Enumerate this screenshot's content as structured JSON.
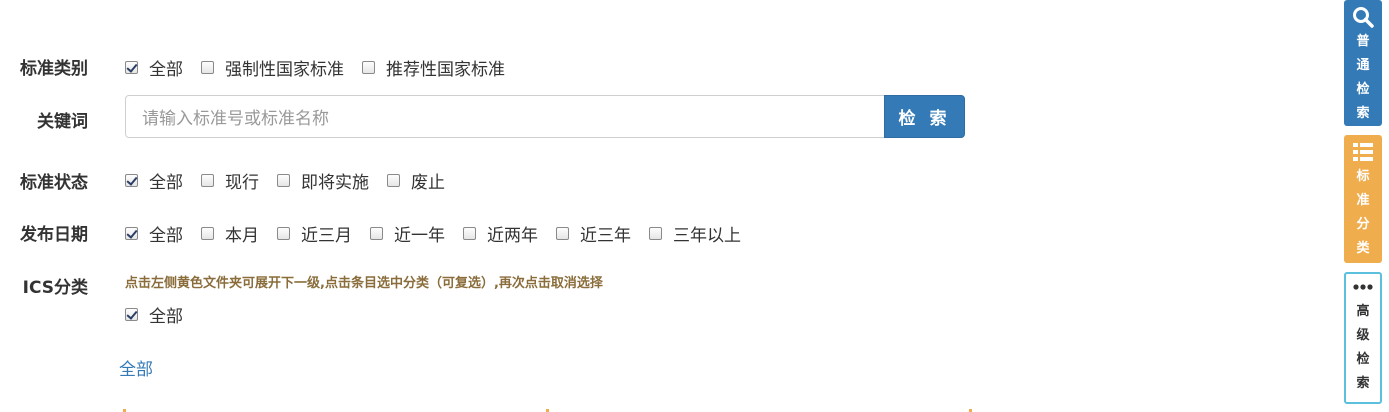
{
  "standard_type": {
    "label": "标准类别",
    "options": [
      {
        "label": "全部",
        "checked": true
      },
      {
        "label": "强制性国家标准",
        "checked": false
      },
      {
        "label": "推荐性国家标准",
        "checked": false
      }
    ]
  },
  "keyword": {
    "label": "关键词",
    "placeholder": "请输入标准号或标准名称",
    "button": "检 索"
  },
  "standard_status": {
    "label": "标准状态",
    "options": [
      {
        "label": "全部",
        "checked": true
      },
      {
        "label": "现行",
        "checked": false
      },
      {
        "label": "即将实施",
        "checked": false
      },
      {
        "label": "废止",
        "checked": false
      }
    ]
  },
  "publish_date": {
    "label": "发布日期",
    "options": [
      {
        "label": "全部",
        "checked": true
      },
      {
        "label": "本月",
        "checked": false
      },
      {
        "label": "近三月",
        "checked": false
      },
      {
        "label": "近一年",
        "checked": false
      },
      {
        "label": "近两年",
        "checked": false
      },
      {
        "label": "近三年",
        "checked": false
      },
      {
        "label": "三年以上",
        "checked": false
      }
    ]
  },
  "ics": {
    "label": "ICS分类",
    "hint": "点击左侧黄色文件夹可展开下一级,点击条目选中分类（可复选）,再次点击取消选择",
    "all_option": {
      "label": "全部",
      "checked": true
    },
    "link_all": "全部"
  },
  "side": {
    "search": [
      "普",
      "通",
      "检",
      "索"
    ],
    "category": [
      "标",
      "准",
      "分",
      "类"
    ],
    "advanced": [
      "高",
      "级",
      "检",
      "索"
    ],
    "search_icon": "search-icon",
    "category_icon": "list-icon",
    "advanced_icon": "ellipsis-icon"
  },
  "colors": {
    "primary": "#337ab7",
    "warning": "#f0ad4e",
    "hint_text": "#8a6d3b"
  }
}
